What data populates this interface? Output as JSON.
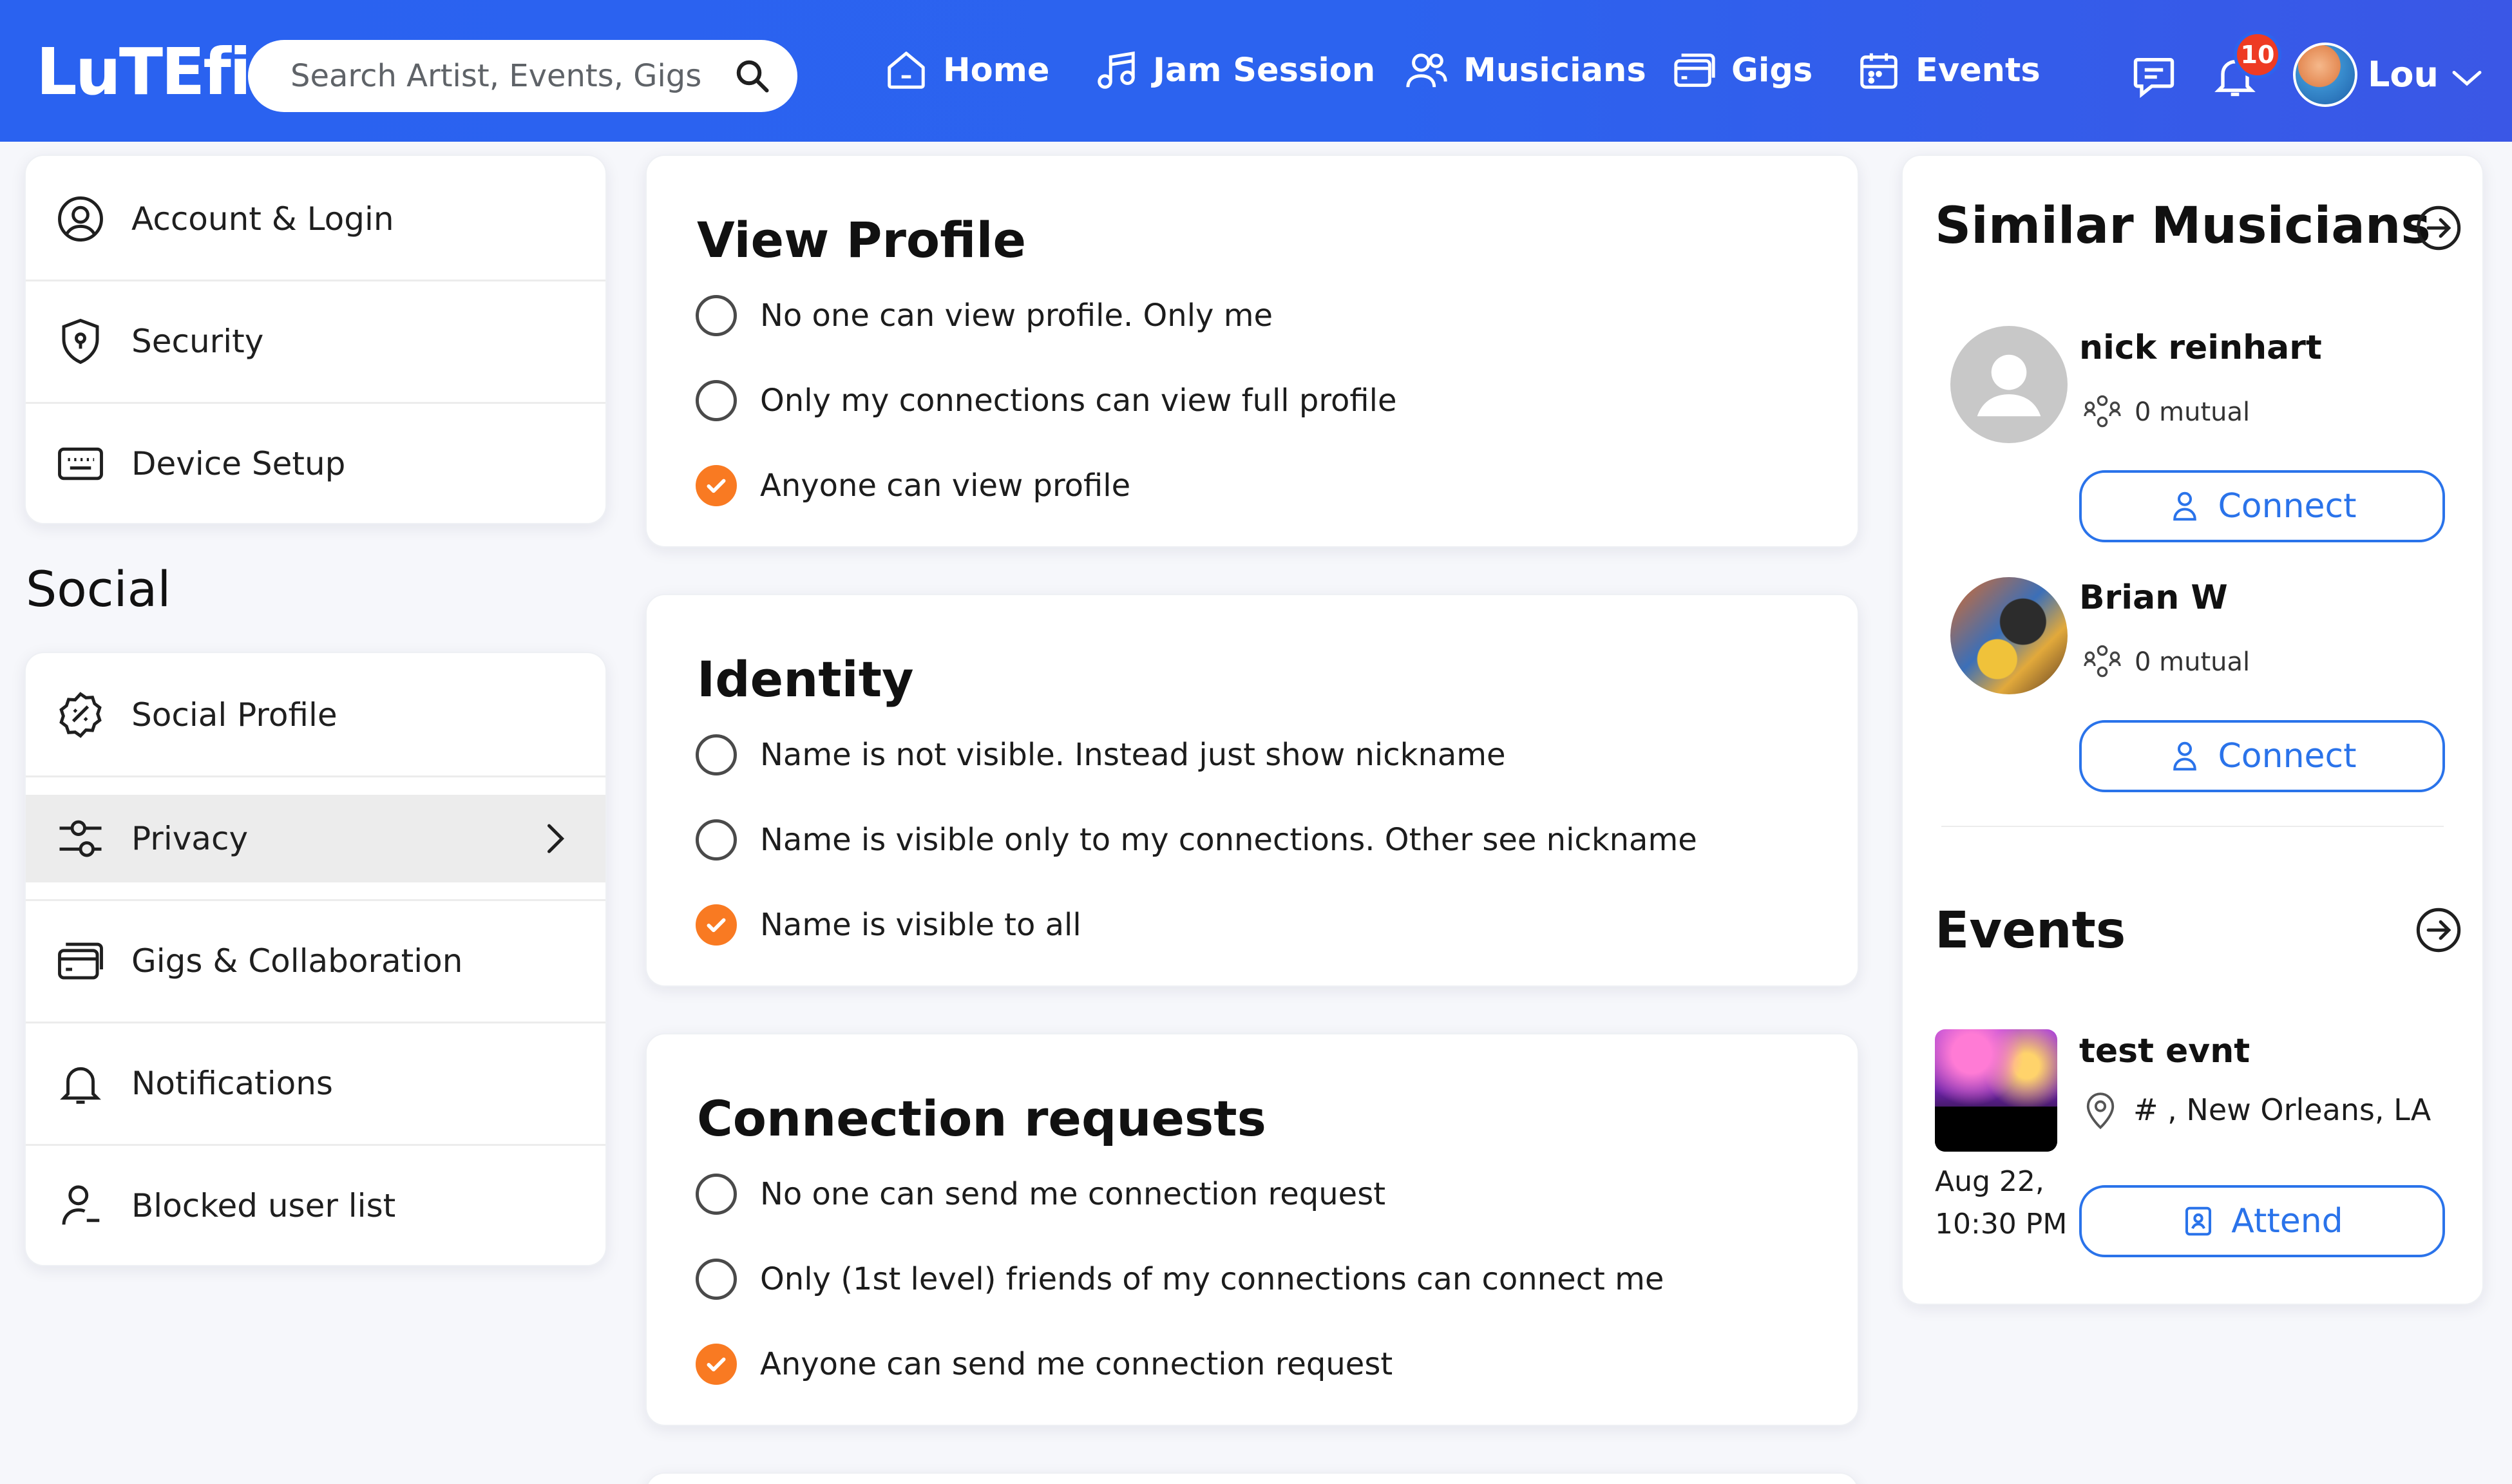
{
  "brand": {
    "logo_text": "LuTEfish"
  },
  "search": {
    "placeholder": "Search Artist, Events, Gigs"
  },
  "nav": {
    "items": [
      {
        "label": "Home",
        "icon": "home-icon"
      },
      {
        "label": "Jam Session",
        "icon": "music-note-icon"
      },
      {
        "label": "Musicians",
        "icon": "users-icon"
      },
      {
        "label": "Gigs",
        "icon": "cards-icon"
      },
      {
        "label": "Events",
        "icon": "calendar-icon"
      }
    ]
  },
  "header": {
    "notification_count": "10",
    "user_name": "Lou"
  },
  "sidebar": {
    "account_items": [
      {
        "label": "Account & Login",
        "icon": "user-circle-icon"
      },
      {
        "label": "Security",
        "icon": "shield-icon"
      },
      {
        "label": "Device Setup",
        "icon": "keyboard-icon"
      }
    ],
    "social_heading": "Social",
    "social_items": [
      {
        "label": "Social Profile",
        "icon": "badge-icon"
      },
      {
        "label": "Privacy",
        "icon": "sliders-icon",
        "active": true
      },
      {
        "label": "Gigs & Collaboration",
        "icon": "cards-icon"
      },
      {
        "label": "Notifications",
        "icon": "bell-icon"
      },
      {
        "label": "Blocked user list",
        "icon": "user-blocked-icon"
      }
    ]
  },
  "privacy": {
    "view_profile": {
      "title": "View Profile",
      "options": [
        "No one can view profile. Only me",
        "Only my connections can view full profile",
        "Anyone can view profile"
      ],
      "selected": 2
    },
    "identity": {
      "title": "Identity",
      "options": [
        "Name is not visible. Instead just show nickname",
        "Name is visible only to my connections. Other see nickname",
        "Name is visible to all"
      ],
      "selected": 2
    },
    "connection_requests": {
      "title": "Connection requests",
      "options": [
        "No one can send me connection request",
        "Only (1st level) friends of my connections can connect me",
        "Anyone can send me connection request"
      ],
      "selected": 2
    }
  },
  "similar_musicians": {
    "title": "Similar Musicians",
    "items": [
      {
        "name": "nick reinhart",
        "mutual": "0 mutual",
        "button": "Connect"
      },
      {
        "name": "Brian W",
        "mutual": "0 mutual",
        "button": "Connect"
      }
    ]
  },
  "events": {
    "title": "Events",
    "items": [
      {
        "name": "test evnt",
        "location": "# , New Orleans, LA",
        "date_line1": "Aug 22,",
        "date_line2": "10:30 PM",
        "button": "Attend"
      }
    ]
  },
  "colors": {
    "header_blue": "#2c63ef",
    "accent_orange": "#f97a22",
    "button_blue": "#2a73ea",
    "badge_red": "#ee3b23"
  }
}
